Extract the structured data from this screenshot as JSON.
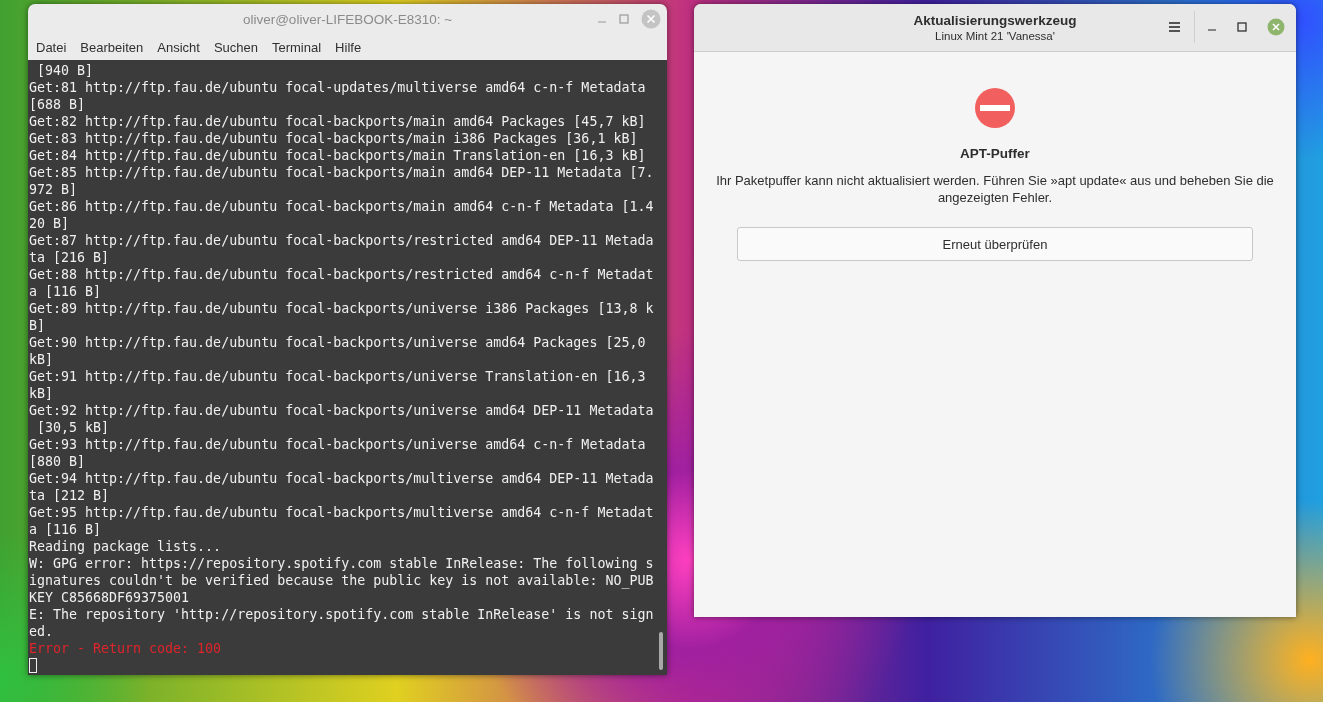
{
  "terminal": {
    "title": "oliver@oliver-LIFEBOOK-E8310: ~",
    "active": false,
    "menu": [
      "Datei",
      "Bearbeiten",
      "Ansicht",
      "Suchen",
      "Terminal",
      "Hilfe"
    ],
    "lines": [
      {
        "text": " [940 B]",
        "kind": "output"
      },
      {
        "text": "Get:81 http://ftp.fau.de/ubuntu focal-updates/multiverse amd64 c-n-f Metadata",
        "kind": "output"
      },
      {
        "text": "[688 B]",
        "kind": "output"
      },
      {
        "text": "Get:82 http://ftp.fau.de/ubuntu focal-backports/main amd64 Packages [45,7 kB]",
        "kind": "output"
      },
      {
        "text": "Get:83 http://ftp.fau.de/ubuntu focal-backports/main i386 Packages [36,1 kB]",
        "kind": "output"
      },
      {
        "text": "Get:84 http://ftp.fau.de/ubuntu focal-backports/main Translation-en [16,3 kB]",
        "kind": "output"
      },
      {
        "text": "Get:85 http://ftp.fau.de/ubuntu focal-backports/main amd64 DEP-11 Metadata [7.",
        "kind": "output"
      },
      {
        "text": "972 B]",
        "kind": "output"
      },
      {
        "text": "Get:86 http://ftp.fau.de/ubuntu focal-backports/main amd64 c-n-f Metadata [1.4",
        "kind": "output"
      },
      {
        "text": "20 B]",
        "kind": "output"
      },
      {
        "text": "Get:87 http://ftp.fau.de/ubuntu focal-backports/restricted amd64 DEP-11 Metada",
        "kind": "output"
      },
      {
        "text": "ta [216 B]",
        "kind": "output"
      },
      {
        "text": "Get:88 http://ftp.fau.de/ubuntu focal-backports/restricted amd64 c-n-f Metadat",
        "kind": "output"
      },
      {
        "text": "a [116 B]",
        "kind": "output"
      },
      {
        "text": "Get:89 http://ftp.fau.de/ubuntu focal-backports/universe i386 Packages [13,8 k",
        "kind": "output"
      },
      {
        "text": "B]",
        "kind": "output"
      },
      {
        "text": "Get:90 http://ftp.fau.de/ubuntu focal-backports/universe amd64 Packages [25,0",
        "kind": "output"
      },
      {
        "text": "kB]",
        "kind": "output"
      },
      {
        "text": "Get:91 http://ftp.fau.de/ubuntu focal-backports/universe Translation-en [16,3",
        "kind": "output"
      },
      {
        "text": "kB]",
        "kind": "output"
      },
      {
        "text": "Get:92 http://ftp.fau.de/ubuntu focal-backports/universe amd64 DEP-11 Metadata",
        "kind": "output"
      },
      {
        "text": " [30,5 kB]",
        "kind": "output"
      },
      {
        "text": "Get:93 http://ftp.fau.de/ubuntu focal-backports/universe amd64 c-n-f Metadata",
        "kind": "output"
      },
      {
        "text": "[880 B]",
        "kind": "output"
      },
      {
        "text": "Get:94 http://ftp.fau.de/ubuntu focal-backports/multiverse amd64 DEP-11 Metada",
        "kind": "output"
      },
      {
        "text": "ta [212 B]",
        "kind": "output"
      },
      {
        "text": "Get:95 http://ftp.fau.de/ubuntu focal-backports/multiverse amd64 c-n-f Metadat",
        "kind": "output"
      },
      {
        "text": "a [116 B]",
        "kind": "output"
      },
      {
        "text": "Reading package lists...",
        "kind": "output"
      },
      {
        "text": "W: GPG error: https://repository.spotify.com stable InRelease: The following s",
        "kind": "output"
      },
      {
        "text": "ignatures couldn't be verified because the public key is not available: NO_PUB",
        "kind": "output"
      },
      {
        "text": "KEY C85668DF69375001",
        "kind": "output"
      },
      {
        "text": "E: The repository 'http://repository.spotify.com stable InRelease' is not sign",
        "kind": "output"
      },
      {
        "text": "ed.",
        "kind": "output"
      },
      {
        "text": "Error - Return code: 100",
        "kind": "error"
      }
    ]
  },
  "updater": {
    "title": "Aktualisierungswerkzeug",
    "subtitle": "Linux Mint 21 'Vanessa'",
    "active": true,
    "status_title": "APT-Puffer",
    "message": "Ihr Paketpuffer kann nicht aktualisiert werden. Führen Sie »apt update« aus und beheben Sie die angezeigten Fehler.",
    "button": "Erneut überprüfen"
  }
}
